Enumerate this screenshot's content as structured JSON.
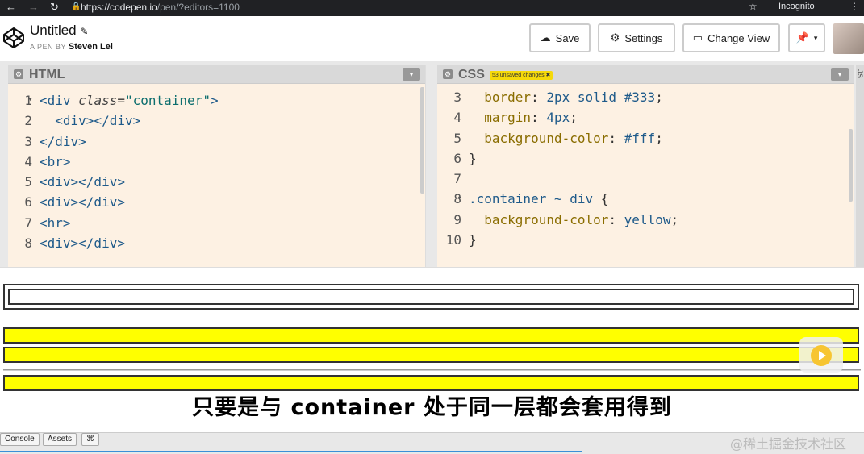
{
  "browser": {
    "url_host": "https://codepen.io",
    "url_path": "/pen/?editors=1100",
    "incognito_label": "Incognito"
  },
  "header": {
    "title": "Untitled",
    "byline_prefix": "A PEN BY",
    "author": "Steven Lei",
    "buttons": {
      "save": "Save",
      "settings": "Settings",
      "change_view": "Change View"
    }
  },
  "html_pane": {
    "label": "HTML",
    "lines": [
      {
        "n": "1",
        "segments": [
          {
            "t": "<div ",
            "c": "tag"
          },
          {
            "t": "class",
            "c": "attr"
          },
          {
            "t": "=",
            "c": ""
          },
          {
            "t": "\"container\"",
            "c": "str"
          },
          {
            "t": ">",
            "c": "tag"
          }
        ]
      },
      {
        "n": "2",
        "segments": [
          {
            "t": "  <div></div>",
            "c": "tag"
          }
        ]
      },
      {
        "n": "3",
        "segments": [
          {
            "t": "</div>",
            "c": "tag"
          }
        ]
      },
      {
        "n": "4",
        "segments": [
          {
            "t": "<br>",
            "c": "tag"
          }
        ]
      },
      {
        "n": "5",
        "segments": [
          {
            "t": "<div></div>",
            "c": "tag"
          }
        ]
      },
      {
        "n": "6",
        "segments": [
          {
            "t": "<div></div>",
            "c": "tag"
          }
        ]
      },
      {
        "n": "7",
        "segments": [
          {
            "t": "<hr>",
            "c": "tag"
          }
        ]
      },
      {
        "n": "8",
        "segments": [
          {
            "t": "<div></div>",
            "c": "tag"
          }
        ]
      }
    ]
  },
  "css_pane": {
    "label": "CSS",
    "unsaved_badge": "53 unsaved changes ✖",
    "lines": [
      {
        "n": "3",
        "segments": [
          {
            "t": "  border",
            "c": "prop"
          },
          {
            "t": ": ",
            "c": ""
          },
          {
            "t": "2px solid #333",
            "c": "val"
          },
          {
            "t": ";",
            "c": ""
          }
        ]
      },
      {
        "n": "4",
        "segments": [
          {
            "t": "  margin",
            "c": "prop"
          },
          {
            "t": ": ",
            "c": ""
          },
          {
            "t": "4px",
            "c": "val"
          },
          {
            "t": ";",
            "c": ""
          }
        ]
      },
      {
        "n": "5",
        "segments": [
          {
            "t": "  background-color",
            "c": "prop"
          },
          {
            "t": ": ",
            "c": ""
          },
          {
            "t": "#fff",
            "c": "val"
          },
          {
            "t": ";",
            "c": ""
          }
        ]
      },
      {
        "n": "6",
        "segments": [
          {
            "t": "}",
            "c": ""
          }
        ]
      },
      {
        "n": "7",
        "segments": []
      },
      {
        "n": "8",
        "segments": [
          {
            "t": ".container ~ div",
            "c": "sel"
          },
          {
            "t": " {",
            "c": ""
          }
        ]
      },
      {
        "n": "9",
        "segments": [
          {
            "t": "  background-color",
            "c": "prop"
          },
          {
            "t": ": ",
            "c": ""
          },
          {
            "t": "yellow",
            "c": "val"
          },
          {
            "t": ";",
            "c": ""
          }
        ]
      },
      {
        "n": "10",
        "segments": [
          {
            "t": "}",
            "c": ""
          }
        ]
      }
    ]
  },
  "js_pane_label": "JS",
  "caption": "只要是与 container 处于同一层都会套用得到",
  "footer": {
    "console": "Console",
    "assets": "Assets",
    "shortcuts": "⌘"
  },
  "watermark": "@稀土掘金技术社区",
  "colors": {
    "preview_yellow": "#ffff00",
    "editor_bg": "#fdf1e3",
    "badge": "#f5d90a"
  }
}
